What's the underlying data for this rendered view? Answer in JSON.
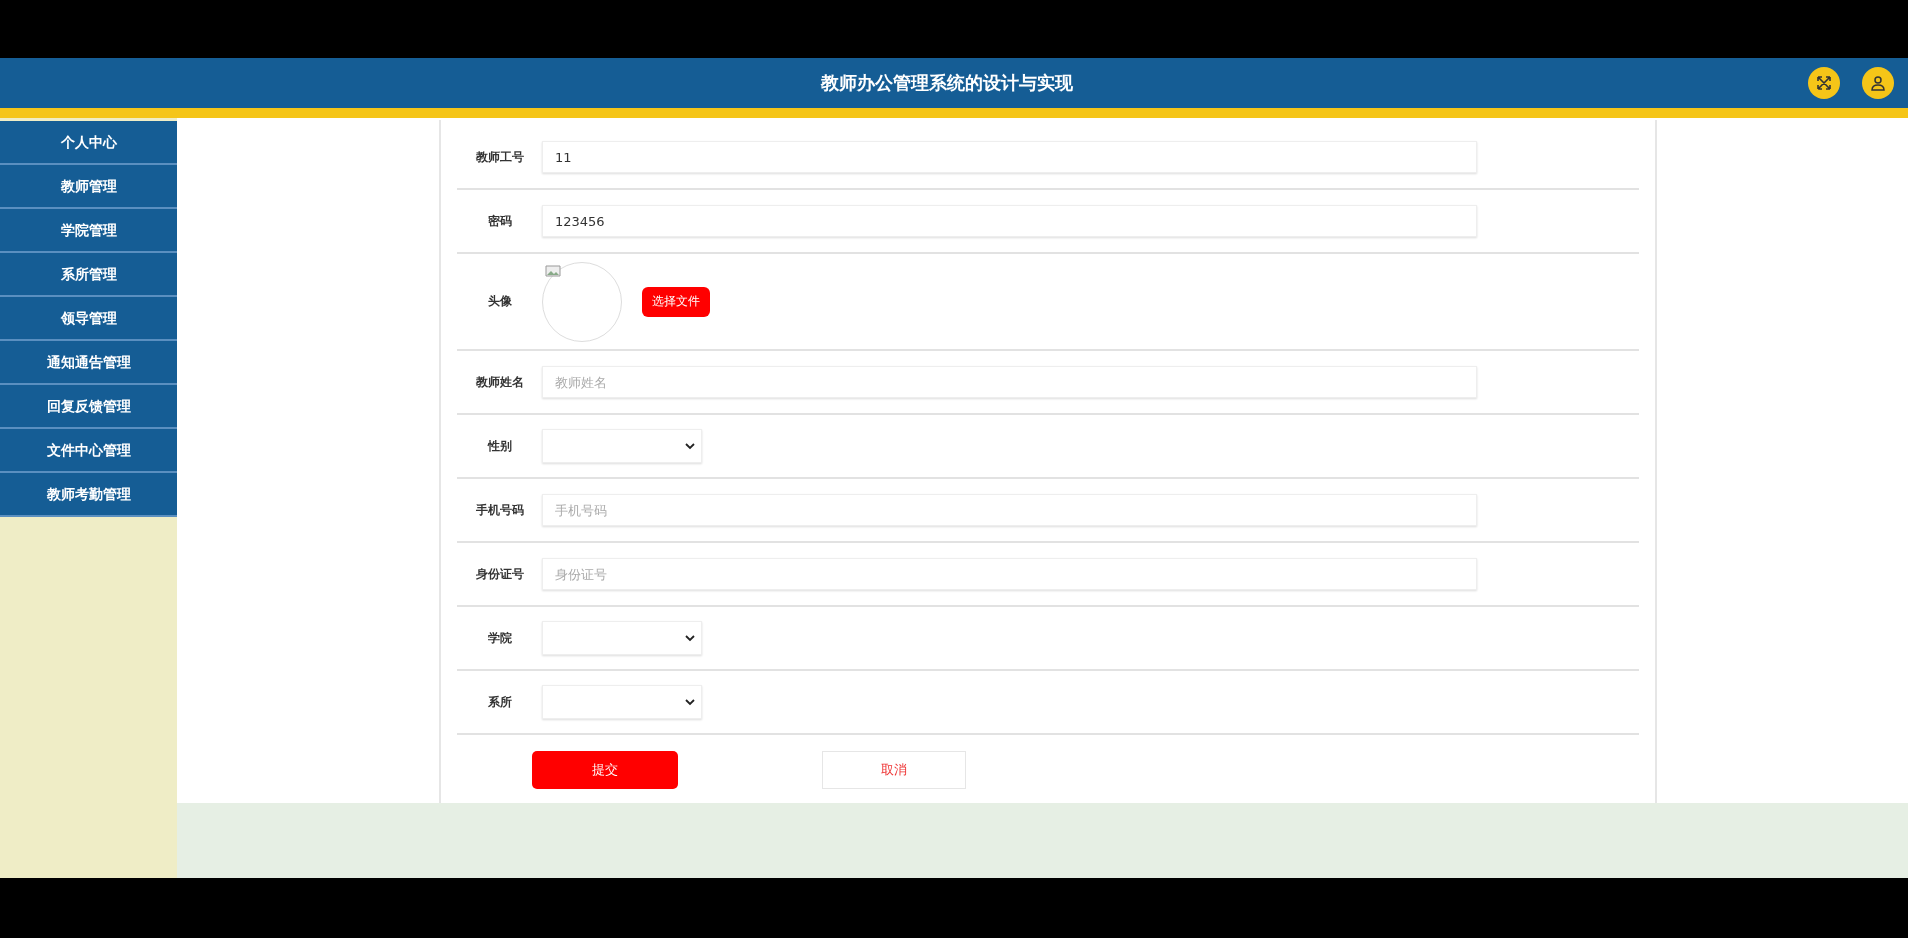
{
  "header": {
    "title": "教师办公管理系统的设计与实现"
  },
  "sidebar": {
    "items": [
      {
        "label": "个人中心"
      },
      {
        "label": "教师管理"
      },
      {
        "label": "学院管理"
      },
      {
        "label": "系所管理"
      },
      {
        "label": "领导管理"
      },
      {
        "label": "通知通告管理"
      },
      {
        "label": "回复反馈管理"
      },
      {
        "label": "文件中心管理"
      },
      {
        "label": "教师考勤管理"
      }
    ]
  },
  "form": {
    "fields": [
      {
        "kind": "text",
        "label": "教师工号",
        "value": "11"
      },
      {
        "kind": "text",
        "label": "密码",
        "value": "123456"
      },
      {
        "kind": "image",
        "label": "头像",
        "button": "选择文件"
      },
      {
        "kind": "text",
        "label": "教师姓名",
        "placeholder": "教师姓名"
      },
      {
        "kind": "select",
        "label": "性别"
      },
      {
        "kind": "text",
        "label": "手机号码",
        "placeholder": "手机号码"
      },
      {
        "kind": "text",
        "label": "身份证号",
        "placeholder": "身份证号"
      },
      {
        "kind": "select",
        "label": "学院"
      },
      {
        "kind": "select",
        "label": "系所"
      }
    ],
    "submit": "提交",
    "cancel": "取消"
  }
}
